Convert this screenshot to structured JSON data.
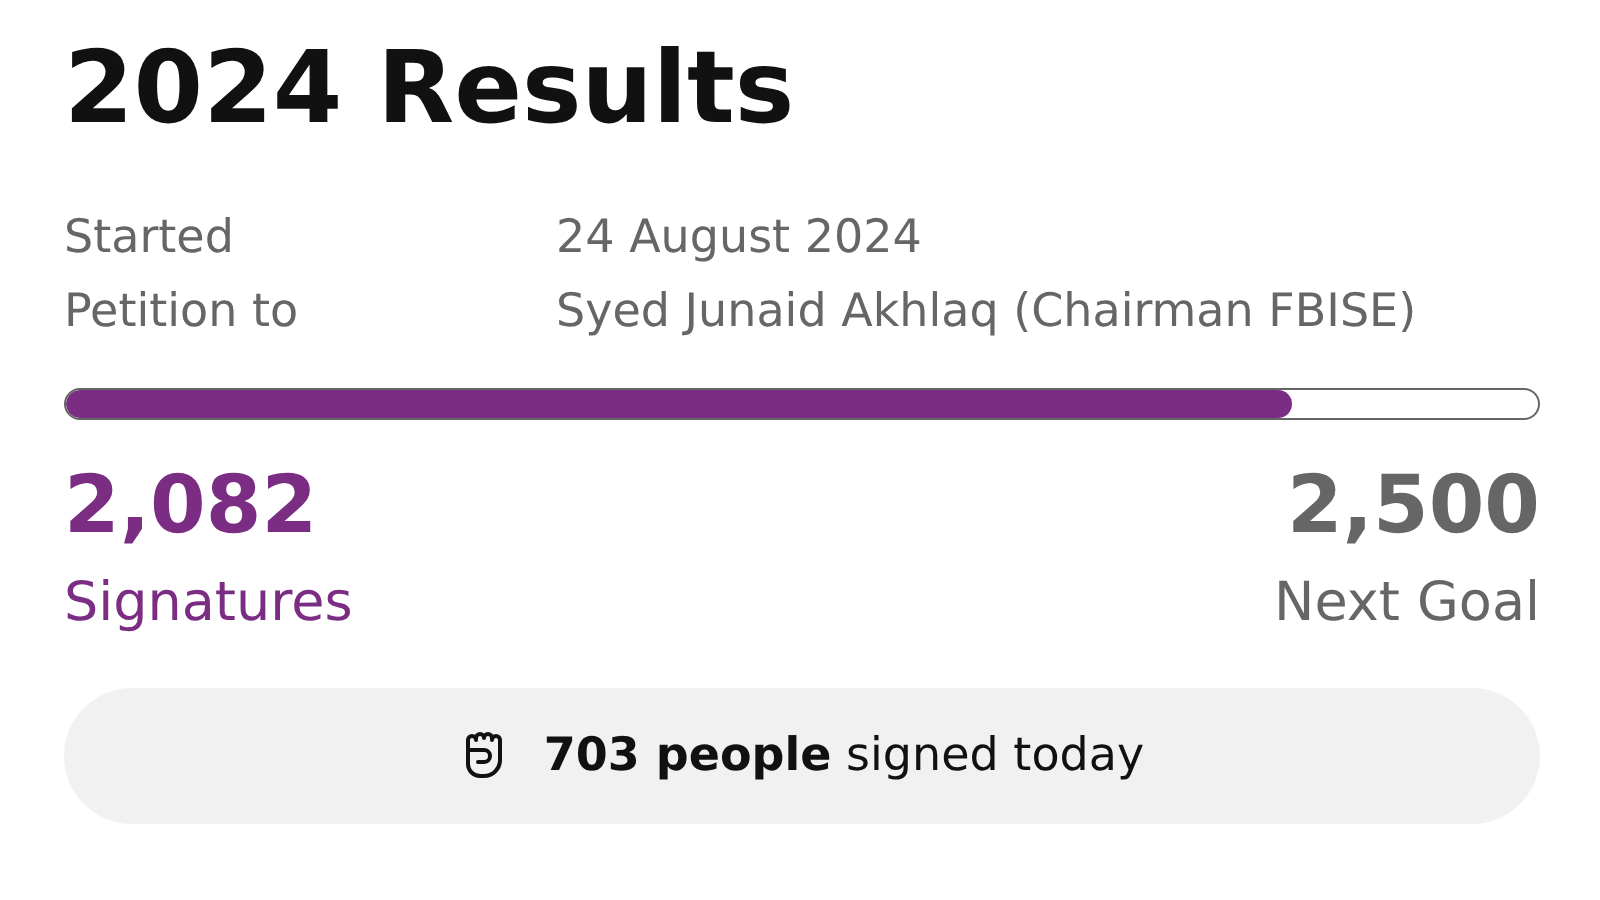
{
  "title": "2024 Results",
  "details": [
    {
      "label": "Started",
      "value": "24 August 2024"
    },
    {
      "label": "Petition to",
      "value": "Syed Junaid Akhlaq (Chairman FBISE)"
    }
  ],
  "progress": {
    "level": 0.833
  },
  "signatures": {
    "count": "2,082",
    "label": "Signatures"
  },
  "goal": {
    "count": "2,500",
    "label": "Next Goal"
  },
  "today": {
    "text": "**703 people** signed today"
  }
}
